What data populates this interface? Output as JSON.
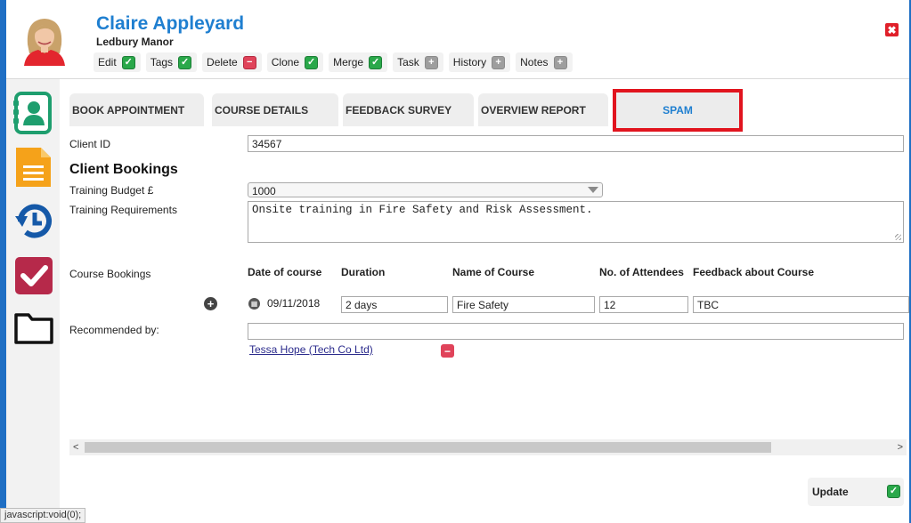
{
  "contact": {
    "name": "Claire Appleyard",
    "organisation": "Ledbury Manor"
  },
  "actions": [
    {
      "label": "Edit",
      "state": "check"
    },
    {
      "label": "Tags",
      "state": "check"
    },
    {
      "label": "Delete",
      "state": "minus"
    },
    {
      "label": "Clone",
      "state": "check"
    },
    {
      "label": "Merge",
      "state": "check"
    },
    {
      "label": "Task",
      "state": "plus"
    },
    {
      "label": "History",
      "state": "plus"
    },
    {
      "label": "Notes",
      "state": "plus"
    }
  ],
  "close": {
    "symbol": "✖"
  },
  "sidebar": {
    "items": [
      {
        "icon": "contact-card-icon",
        "color": "#1e9e6e"
      },
      {
        "icon": "document-icon",
        "color": "#f5a21a"
      },
      {
        "icon": "history-icon",
        "color": "#1559a8"
      },
      {
        "icon": "checkbox-icon",
        "color": "#b6294a"
      },
      {
        "icon": "folder-icon",
        "color": "#111111"
      }
    ]
  },
  "tabs": [
    {
      "label": "BOOK APPOINTMENT",
      "active": false
    },
    {
      "label": "COURSE DETAILS",
      "active": false
    },
    {
      "label": "FEEDBACK SURVEY",
      "active": false
    },
    {
      "label": "OVERVIEW REPORT",
      "active": false
    },
    {
      "label": "SPAM",
      "active": true
    }
  ],
  "form": {
    "client_id_label": "Client ID",
    "client_id_value": "34567",
    "section_title": "Client Bookings",
    "budget_label": "Training Budget £",
    "budget_value": "1000",
    "requirements_label": "Training Requirements",
    "requirements_value": "Onsite training in Fire Safety and Risk Assessment.",
    "course_bookings_label": "Course Bookings",
    "columns": [
      "Date of course",
      "Duration",
      "Name of Course",
      "No. of Attendees",
      "Feedback about Course"
    ],
    "booking": {
      "date": "09/11/2018",
      "duration": "2 days",
      "course": "Fire Safety",
      "attendees": "12",
      "feedback": "TBC"
    },
    "recommended_label": "Recommended by:",
    "recommended_value": "",
    "recommender_link": "Tessa Hope (Tech Co Ltd)"
  },
  "update_label": "Update",
  "status_text": "javascript:void(0);",
  "colors": {
    "accent": "#1f7fd0",
    "tab_highlight": "#e1141e",
    "background": "#1f6fc4"
  }
}
